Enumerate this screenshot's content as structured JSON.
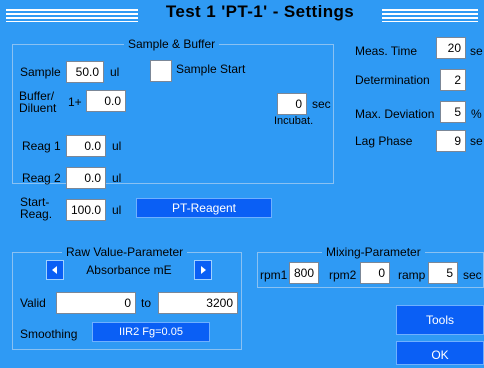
{
  "title": "Test  1  'PT-1'  -  Settings",
  "sample_buffer": {
    "title": "Sample  &  Buffer",
    "sample_label": "Sample",
    "sample_value": "50.0",
    "sample_unit": "ul",
    "sample_start_label": "Sample  Start",
    "buffer_label_line1": "Buffer/",
    "buffer_label_line2": "Diluent",
    "buffer_prefix": "1+",
    "buffer_value": "0.0",
    "incubat_value": "0",
    "incubat_unit": "sec",
    "incubat_label": "Incubat."
  },
  "reagents": {
    "reag1_label": "Reag  1",
    "reag1_value": "0.0",
    "reag1_unit": "ul",
    "reag2_label": "Reag  2",
    "reag2_value": "0.0",
    "reag2_unit": "ul",
    "start_label_line1": "Start-",
    "start_label_line2": "Reag.",
    "start_value": "100.0",
    "start_unit": "ul",
    "reagent_button": "PT-Reagent"
  },
  "measurement": {
    "meas_time_label": "Meas.  Time",
    "meas_time_value": "20",
    "meas_time_unit": "se",
    "determination_label": "Determination",
    "determination_value": "2",
    "max_dev_label": "Max.  Deviation",
    "max_dev_value": "5",
    "max_dev_unit": "%",
    "lag_label": "Lag  Phase",
    "lag_value": "9",
    "lag_unit": "se"
  },
  "raw_value": {
    "title": "Raw  Value-Parameter",
    "selector_value": "Absorbance  mE",
    "valid_label": "Valid",
    "valid_from": "0",
    "valid_to_label": "to",
    "valid_to": "3200",
    "smoothing_label": "Smoothing",
    "smoothing_button": "IIR2  Fg=0.05"
  },
  "mixing": {
    "title": "Mixing-Parameter",
    "rpm1_label": "rpm1",
    "rpm1_value": "800",
    "rpm2_label": "rpm2",
    "rpm2_value": "0",
    "ramp_label": "ramp",
    "ramp_value": "5",
    "ramp_unit": "sec"
  },
  "buttons": {
    "tools": "Tools",
    "ok": "OK"
  },
  "colors": {
    "background": "#2f9af4",
    "button": "#0a5ff5",
    "field": "#ffffff"
  }
}
